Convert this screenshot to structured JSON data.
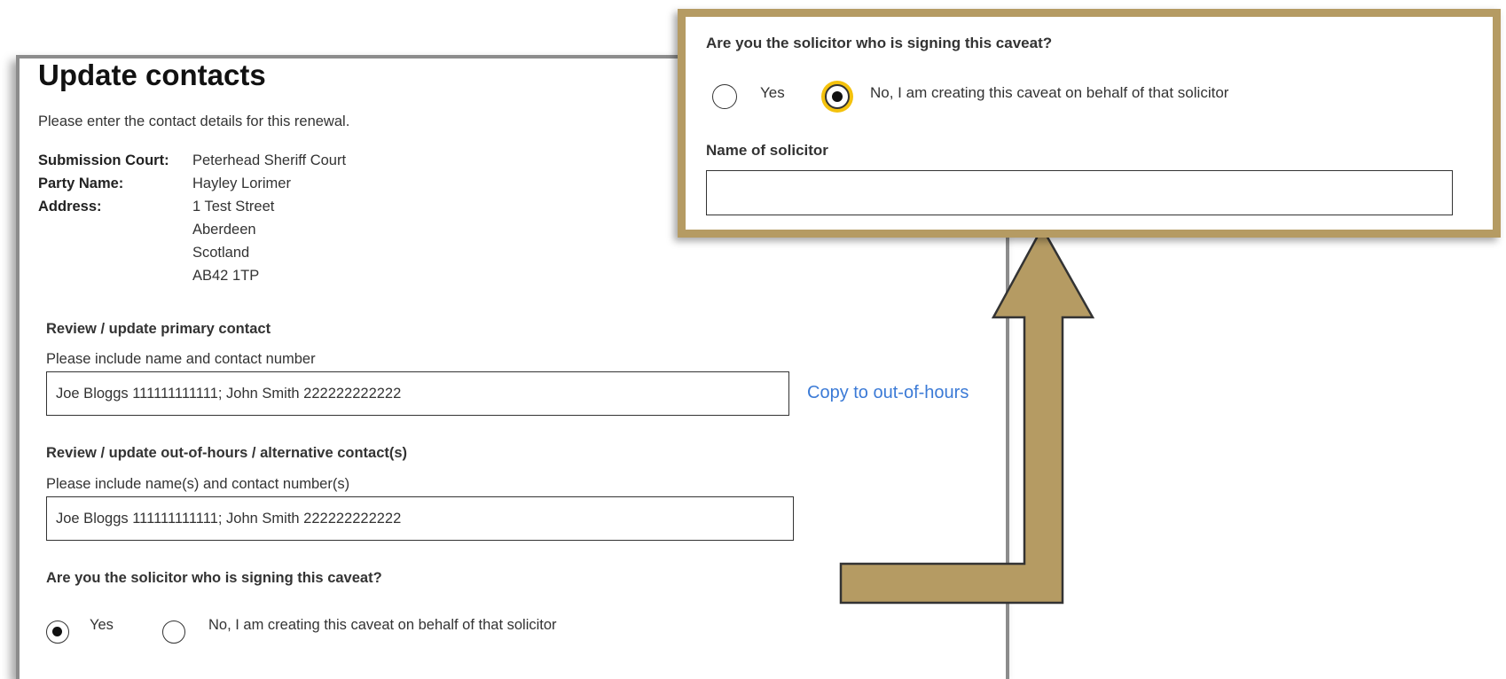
{
  "main": {
    "title": "Update contacts",
    "intro": "Please enter the contact details for this renewal.",
    "details": {
      "court_label": "Submission Court:",
      "court_value": "Peterhead Sheriff Court",
      "party_label": "Party Name:",
      "party_value": "Hayley Lorimer",
      "address_label": "Address:",
      "address_lines": [
        "1 Test Street",
        "Aberdeen",
        "Scotland",
        "AB42 1TP"
      ]
    },
    "primary": {
      "heading": "Review / update primary contact",
      "hint": "Please include name and contact number",
      "value": "Joe Bloggs 111111111111; John Smith 222222222222",
      "copy_link": "Copy to out-of-hours"
    },
    "alternative": {
      "heading": "Review / update out-of-hours / alternative contact(s)",
      "hint": "Please include name(s) and contact number(s)",
      "value": "Joe Bloggs 111111111111; John Smith 222222222222"
    },
    "solicitor": {
      "question": "Are you the solicitor who is signing this caveat?",
      "yes_label": "Yes",
      "no_label": "No, I am creating this caveat on behalf of that solicitor",
      "selected": "Yes"
    }
  },
  "callout": {
    "question": "Are you the solicitor who is signing this caveat?",
    "yes_label": "Yes",
    "no_label": "No, I am creating this caveat on behalf of that solicitor",
    "selected": "No",
    "name_label": "Name of solicitor",
    "name_value": ""
  },
  "colors": {
    "callout_border": "#b59b63",
    "arrow_fill": "#b59b63",
    "focus_ring": "#f4c20d",
    "link": "#3b7ad6"
  }
}
